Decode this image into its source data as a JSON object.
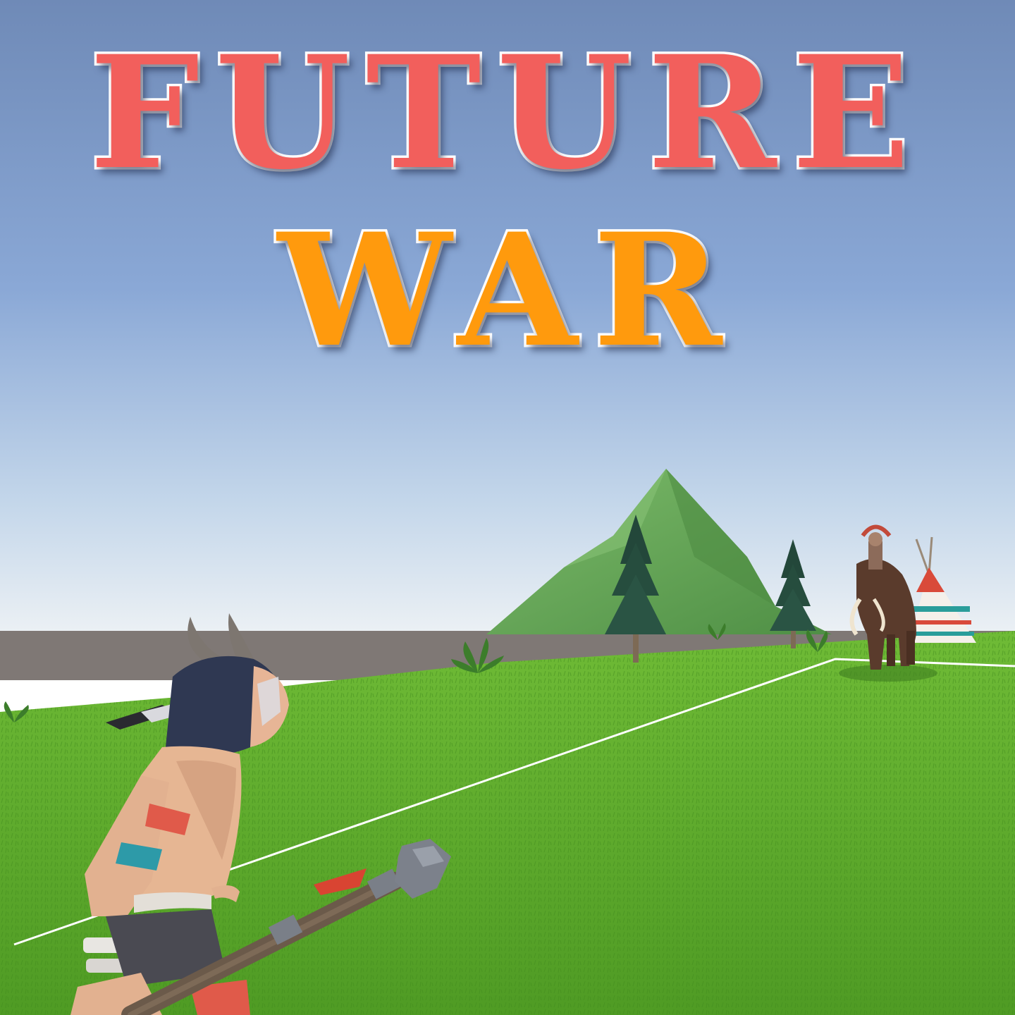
{
  "title": {
    "line1": "FUTURE",
    "line2": "WAR"
  },
  "colors": {
    "title_line1": "#f25f5c",
    "title_line2": "#ff9a0d",
    "title_outline": "#ffffff",
    "sky_top": "#6f8ab7",
    "sky_horizon": "#e6edf3",
    "grass": "#5fae2c",
    "mountain": "#67a85a"
  },
  "scene": {
    "player": "tribal-warrior-with-stone-club",
    "enemy": "mammoth-rider",
    "props": [
      "mountain",
      "pine-tree",
      "pine-tree",
      "fern",
      "fern",
      "teepee",
      "boundary-line"
    ]
  }
}
